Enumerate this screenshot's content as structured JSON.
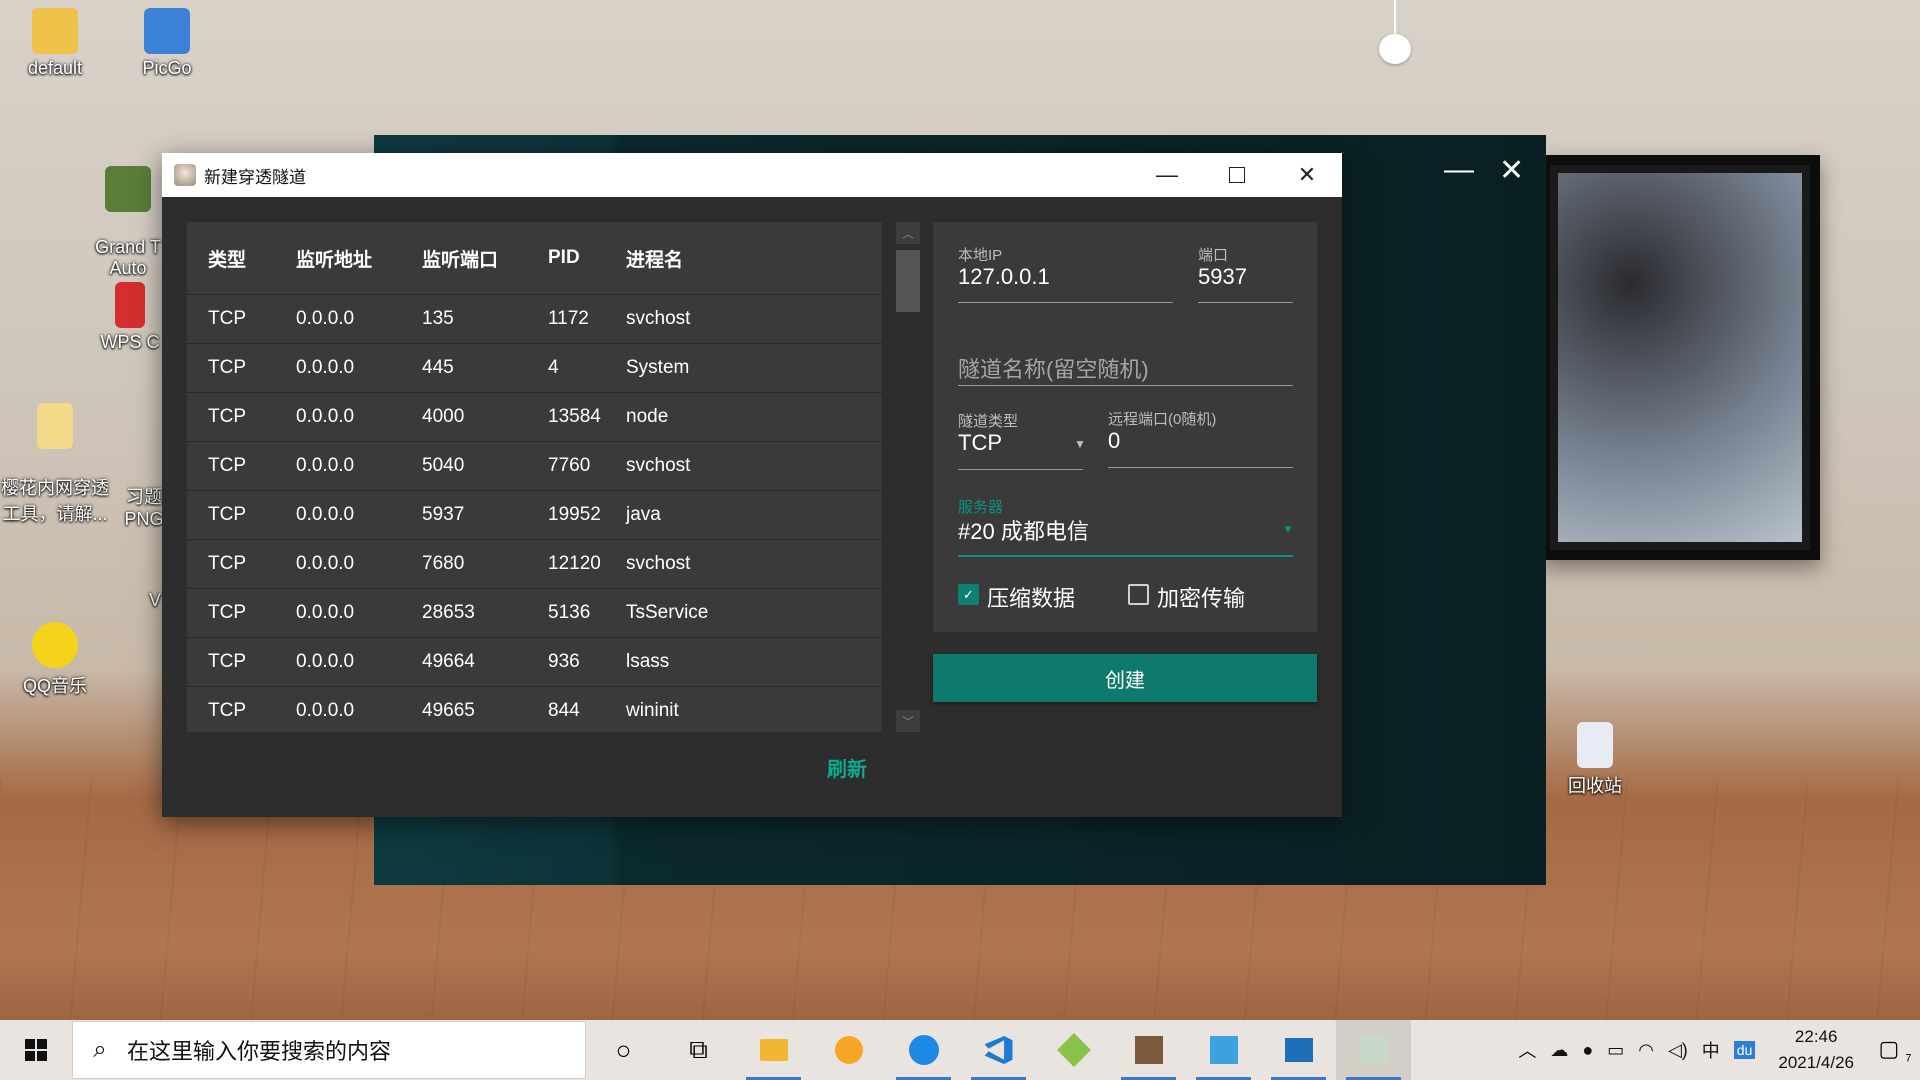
{
  "desktop": {
    "icons": [
      {
        "label": "default"
      },
      {
        "label": "PicGo"
      },
      {
        "label": "Grand T\nAuto"
      },
      {
        "label": "WPS C"
      },
      {
        "label": "樱花内网穿透\n工具，请解..."
      },
      {
        "label": "习题\nPNG"
      },
      {
        "label": "V"
      },
      {
        "label": "QQ音乐"
      },
      {
        "label": "回收站"
      }
    ]
  },
  "dialog": {
    "title": "新建穿透隧道",
    "table": {
      "headers": [
        "类型",
        "监听地址",
        "监听端口",
        "PID",
        "进程名"
      ],
      "rows": [
        [
          "TCP",
          "0.0.0.0",
          "135",
          "1172",
          "svchost"
        ],
        [
          "TCP",
          "0.0.0.0",
          "445",
          "4",
          "System"
        ],
        [
          "TCP",
          "0.0.0.0",
          "4000",
          "13584",
          "node"
        ],
        [
          "TCP",
          "0.0.0.0",
          "5040",
          "7760",
          "svchost"
        ],
        [
          "TCP",
          "0.0.0.0",
          "5937",
          "19952",
          "java"
        ],
        [
          "TCP",
          "0.0.0.0",
          "7680",
          "12120",
          "svchost"
        ],
        [
          "TCP",
          "0.0.0.0",
          "28653",
          "5136",
          "TsService"
        ],
        [
          "TCP",
          "0.0.0.0",
          "49664",
          "936",
          "lsass"
        ],
        [
          "TCP",
          "0.0.0.0",
          "49665",
          "844",
          "wininit"
        ]
      ]
    },
    "refresh_label": "刷新",
    "form": {
      "local_ip_label": "本地IP",
      "local_ip_value": "127.0.0.1",
      "port_label": "端口",
      "port_value": "5937",
      "tunnel_name_placeholder": "隧道名称(留空随机)",
      "tunnel_type_label": "隧道类型",
      "tunnel_type_value": "TCP",
      "remote_port_label": "远程端口(0随机)",
      "remote_port_value": "0",
      "server_label": "服务器",
      "server_value": "#20 成都电信",
      "compress_label": "压缩数据",
      "compress_checked": true,
      "encrypt_label": "加密传输",
      "encrypt_checked": false
    },
    "create_label": "创建"
  },
  "taskbar": {
    "search_placeholder": "在这里输入你要搜索的内容",
    "apps": [
      "cortana-icon",
      "task-view-icon",
      "file-explorer-icon",
      "browser-icon",
      "edge-icon",
      "vscode-icon",
      "git-icon",
      "minecraft-icon",
      "photo-app-icon",
      "photos-icon",
      "anime-app-icon"
    ],
    "ime": "中",
    "time": "22:46",
    "date": "2021/4/26",
    "notification_count": "7"
  },
  "colors": {
    "accent": "#0e7a6d",
    "refresh": "#10a88f",
    "dialog_bg": "#2d2d2d",
    "card_bg": "#3a3a3a"
  }
}
